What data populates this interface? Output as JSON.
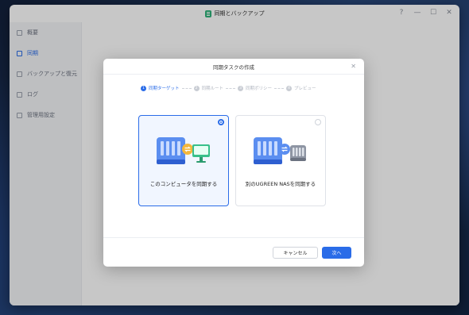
{
  "window": {
    "title": "同期とバックアップ",
    "controls": [
      "?",
      "—",
      "☐",
      "✕"
    ]
  },
  "sidebar": {
    "items": [
      {
        "label": "概要",
        "icon": "overview-icon",
        "active": false
      },
      {
        "label": "同期",
        "icon": "sync-icon",
        "active": true
      },
      {
        "label": "バックアップと復元",
        "icon": "backup-icon",
        "active": false
      },
      {
        "label": "ログ",
        "icon": "log-icon",
        "active": false
      },
      {
        "label": "管理用設定",
        "icon": "settings-icon",
        "active": false
      }
    ]
  },
  "dialog": {
    "title": "同期タスクの作成",
    "steps": [
      {
        "num": "1",
        "label": "同期ターゲット",
        "active": true
      },
      {
        "num": "2",
        "label": "同期ルート",
        "active": false
      },
      {
        "num": "3",
        "label": "同期ポリシー",
        "active": false
      },
      {
        "num": "4",
        "label": "プレビュー",
        "active": false
      }
    ],
    "options": [
      {
        "label": "このコンピュータを同期する",
        "selected": true
      },
      {
        "label": "別のUGREEN NASを同期する",
        "selected": false
      }
    ],
    "cancel_label": "キャンセル",
    "next_label": "次へ"
  },
  "colors": {
    "accent": "#2a6ce8",
    "nas_blue": "#5b8ef0",
    "sync_yellow": "#f4b73c",
    "monitor_green": "#38c08a"
  }
}
